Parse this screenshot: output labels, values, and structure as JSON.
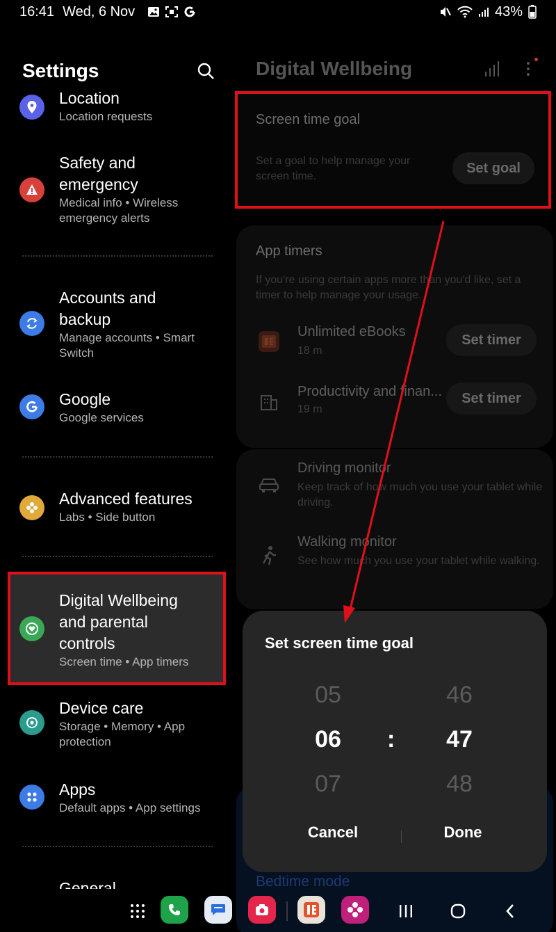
{
  "status_bar": {
    "time": "16:41",
    "date": "Wed, 6 Nov",
    "battery": "43%"
  },
  "settings": {
    "title": "Settings",
    "items": [
      {
        "title": "Location",
        "subtitle": "Location requests"
      },
      {
        "title": "Safety and emergency",
        "subtitle": "Medical info  •  Wireless emergency alerts"
      },
      {
        "title": "Accounts and backup",
        "subtitle": "Manage accounts  •  Smart Switch"
      },
      {
        "title": "Google",
        "subtitle": "Google services"
      },
      {
        "title": "Advanced features",
        "subtitle": "Labs  •  Side button"
      },
      {
        "title": "Digital Wellbeing and parental controls",
        "subtitle": "Screen time  •  App timers"
      },
      {
        "title": "Device care",
        "subtitle": "Storage  •  Memory  •  App protection"
      },
      {
        "title": "Apps",
        "subtitle": "Default apps  •  App settings"
      },
      {
        "title": "General",
        "subtitle": ""
      }
    ]
  },
  "wellbeing": {
    "title": "Digital Wellbeing",
    "screen_time_goal": {
      "title": "Screen time goal",
      "description": "Set a goal to help manage your screen time.",
      "button": "Set goal"
    },
    "app_timers": {
      "title": "App timers",
      "description": "If you're using certain apps more than you'd like, set a timer to help manage your usage.",
      "apps": [
        {
          "name": "Unlimited eBooks",
          "time": "18 m",
          "button": "Set timer"
        },
        {
          "name": "Productivity and finan...",
          "time": "19 m",
          "button": "Set timer"
        }
      ]
    },
    "driving_monitor": {
      "title": "Driving monitor",
      "description": "Keep track of how much you use your tablet while driving."
    },
    "walking_monitor": {
      "title": "Walking monitor",
      "description": "See how much you use your tablet while walking."
    },
    "bedtime_mode": "Bedtime mode"
  },
  "dialog": {
    "title": "Set screen time goal",
    "hours": {
      "prev": "05",
      "selected": "06",
      "next": "07"
    },
    "minutes": {
      "prev": "46",
      "selected": "47",
      "next": "48"
    },
    "separator": ":",
    "cancel": "Cancel",
    "done": "Done"
  },
  "colors": {
    "highlight": "#e0101a",
    "location_icon": "#5a63e8",
    "safety_icon": "#d8413a",
    "accounts_icon": "#3d7be6",
    "google_icon": "#3d7be6",
    "advanced_icon": "#e0a93a",
    "wellbeing_icon": "#3aa955",
    "device_care_icon": "#2a9d8f",
    "apps_icon": "#3d7be6"
  }
}
